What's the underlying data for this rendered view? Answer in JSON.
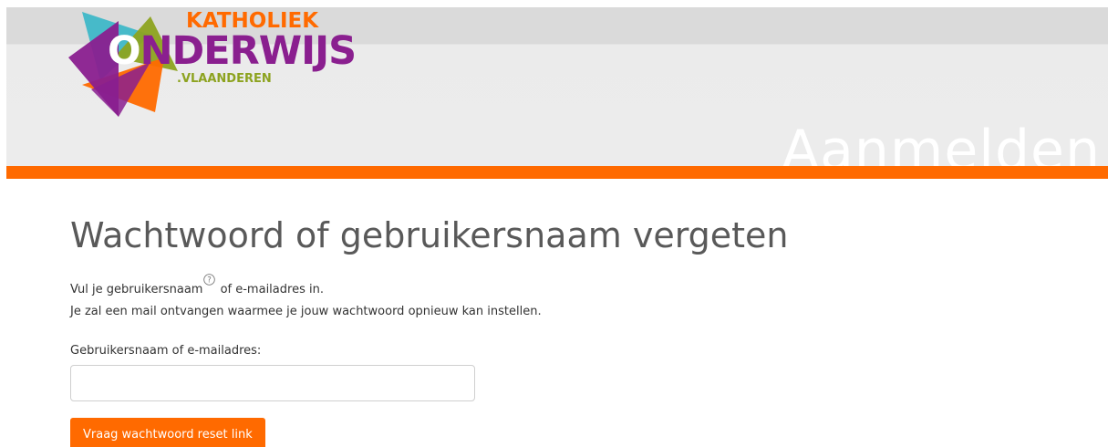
{
  "header": {
    "logo": {
      "line1": "KATHOLIEK",
      "line2_first_letter": "O",
      "line2_rest": "NDERWIJS",
      "line3": ".VLAANDEREN"
    },
    "watermark": "Aanmelden"
  },
  "main": {
    "title": "Wachtwoord of gebruikersnaam vergeten",
    "intro_line1_before": "Vul je gebruikersnaam",
    "intro_line1_after": " of e-mailadres in.",
    "intro_line2": "Je zal een mail ontvangen waarmee je jouw wachtwoord opnieuw kan instellen.",
    "help_icon": "question-circle-icon",
    "field_label": "Gebruikersnaam of e-mailadres:",
    "field_value": "",
    "submit_label": "Vraag wachtwoord reset link"
  },
  "colors": {
    "accent": "#ff6a00",
    "logo_purple": "#8a1f8f",
    "logo_green": "#8da320",
    "logo_teal": "#3fb8c8",
    "title_gray": "#595959"
  }
}
